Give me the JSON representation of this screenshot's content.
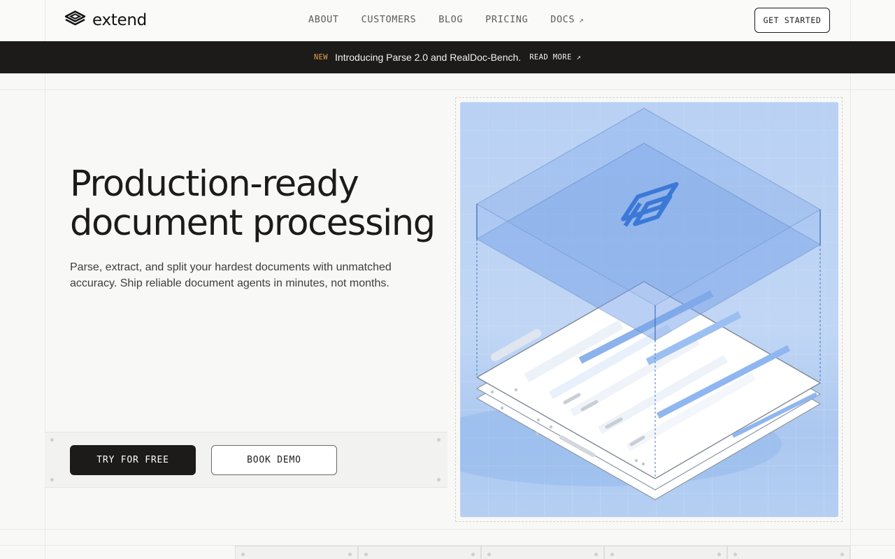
{
  "header": {
    "logo_text": "extend",
    "nav": [
      {
        "label": "ABOUT"
      },
      {
        "label": "CUSTOMERS"
      },
      {
        "label": "BLOG"
      },
      {
        "label": "PRICING"
      },
      {
        "label": "DOCS",
        "external": true
      }
    ],
    "cta_label": "GET STARTED"
  },
  "announcement": {
    "badge": "NEW",
    "message": "Introducing Parse 2.0 and RealDoc-Bench.",
    "link_label": "READ MORE"
  },
  "hero": {
    "title_line1": "Production-ready",
    "title_line2": "document processing",
    "subtitle": "Parse, extract, and split your hardest documents with unmatched accuracy. Ship reliable document agents in minutes, not months.",
    "primary_cta": "TRY FOR FREE",
    "secondary_cta": "BOOK DEMO"
  },
  "icons": {
    "logo": "layers-logo-icon",
    "external": "arrow-up-right-icon"
  },
  "colors": {
    "dark": "#1c1b19",
    "accent_new": "#e2a04c",
    "illustration_blue": "#4d86d6",
    "page_bg": "#f8f8f7"
  }
}
